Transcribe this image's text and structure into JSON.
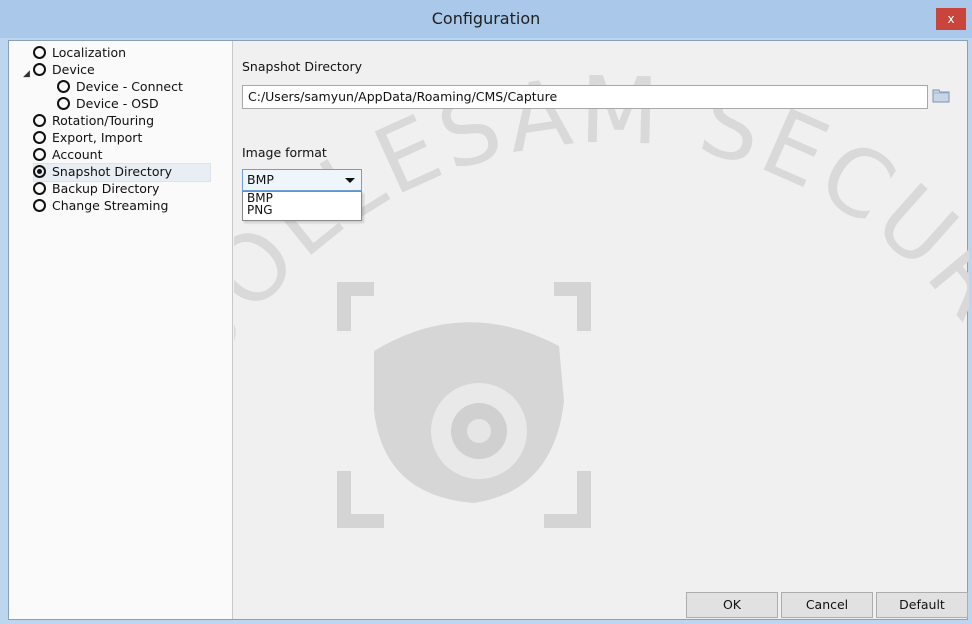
{
  "window": {
    "title": "Configuration",
    "close_label": "x"
  },
  "tree": {
    "items": [
      {
        "label": "Localization"
      },
      {
        "label": "Device"
      },
      {
        "label": "Device - Connect"
      },
      {
        "label": "Device - OSD"
      },
      {
        "label": "Rotation/Touring"
      },
      {
        "label": "Export, Import"
      },
      {
        "label": "Account"
      },
      {
        "label": "Snapshot Directory"
      },
      {
        "label": "Backup Directory"
      },
      {
        "label": "Change Streaming"
      }
    ],
    "selected": "Snapshot Directory",
    "expander_glyph": "◢"
  },
  "panel": {
    "snapshot_label": "Snapshot Directory",
    "snapshot_path": "C:/Users/samyun/AppData/Roaming/CMS/Capture",
    "folder_icon": "folder-icon",
    "image_format_label": "Image format",
    "image_format_value": "BMP",
    "image_format_options": [
      "BMP",
      "PNG"
    ]
  },
  "watermark": {
    "text": "DOLLESAM SECURITY"
  },
  "buttons": {
    "ok": "OK",
    "cancel": "Cancel",
    "default": "Default"
  },
  "colors": {
    "titlebar": "#a9c8ea",
    "close": "#c9443b",
    "combo_border": "#6c9fd8"
  }
}
